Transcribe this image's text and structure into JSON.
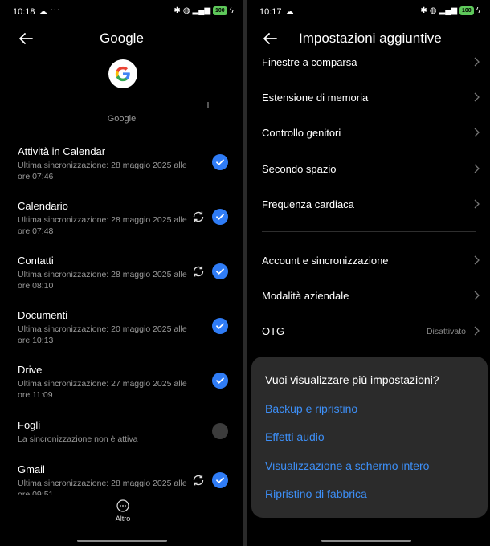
{
  "left": {
    "status": {
      "time": "10:18",
      "dots": "···",
      "battery": "100"
    },
    "header": {
      "title": "Google"
    },
    "account_label": "Google",
    "items": [
      {
        "name": "Attività in Calendar",
        "sub": "Ultima sincronizzazione: 28 maggio 2025 alle ore 07:46",
        "checked": true,
        "syncing": false
      },
      {
        "name": "Calendario",
        "sub": "Ultima sincronizzazione: 28 maggio 2025 alle ore 07:48",
        "checked": true,
        "syncing": true
      },
      {
        "name": "Contatti",
        "sub": "Ultima sincronizzazione: 28 maggio 2025 alle ore 08:10",
        "checked": true,
        "syncing": true
      },
      {
        "name": "Documenti",
        "sub": "Ultima sincronizzazione: 20 maggio 2025 alle ore 10:13",
        "checked": true,
        "syncing": false
      },
      {
        "name": "Drive",
        "sub": "Ultima sincronizzazione: 27 maggio 2025 alle ore 11:09",
        "checked": true,
        "syncing": false
      },
      {
        "name": "Fogli",
        "sub": "La sincronizzazione non è attiva",
        "checked": false,
        "syncing": false
      },
      {
        "name": "Gmail",
        "sub": "Ultima sincronizzazione: 28 maggio 2025 alle ore 09:51",
        "checked": true,
        "syncing": true
      }
    ],
    "more_label": "Altro"
  },
  "right": {
    "status": {
      "time": "10:17",
      "dots": "···",
      "battery": "100"
    },
    "header": {
      "title": "Impostazioni aggiuntive"
    },
    "settings": [
      {
        "label": "Finestre a comparsa",
        "value": ""
      },
      {
        "label": "Estensione di memoria",
        "value": ""
      },
      {
        "label": "Controllo genitori",
        "value": ""
      },
      {
        "label": "Secondo spazio",
        "value": ""
      },
      {
        "label": "Frequenza cardiaca",
        "value": ""
      },
      {
        "label": "Account e sincronizzazione",
        "value": ""
      },
      {
        "label": "Modalità aziendale",
        "value": ""
      },
      {
        "label": "OTG",
        "value": "Disattivato"
      }
    ],
    "dialog": {
      "question": "Vuoi visualizzare più impostazioni?",
      "options": [
        "Backup e ripristino",
        "Effetti audio",
        "Visualizzazione a schermo intero",
        "Ripristino di fabbrica"
      ]
    }
  },
  "colors": {
    "accent": "#2f7cf6",
    "link": "#3d8ff7",
    "battery": "#5ec85a"
  }
}
